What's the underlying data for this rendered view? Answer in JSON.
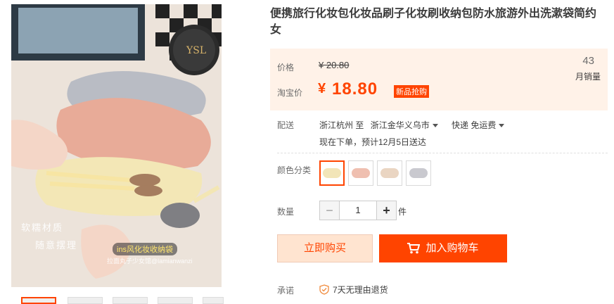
{
  "product": {
    "title": "便携旅行化妆包化妆品刷子化妆刷收纳包防水旅游外出洗漱袋简约女"
  },
  "photo": {
    "overlay_line1": "软糯材质",
    "overlay_line2": "随意摆理",
    "banner": "ins风化妆收纳袋",
    "handle": "拉面丸子少女馆@lamianwanzi"
  },
  "price": {
    "label": "价格",
    "original": "¥ 20.80",
    "tb_label": "淘宝价",
    "currency": "¥",
    "current": "18.80",
    "badge": "新品抢购",
    "sales_count": "43",
    "sales_label": "月销量"
  },
  "delivery": {
    "label": "配送",
    "from": "浙江杭州 至",
    "to": "浙江金华义乌市",
    "shipping": "快递 免运费",
    "note": "现在下单，预计12月5日送达"
  },
  "color": {
    "label": "颜色分类",
    "options": [
      "#f2e5b8",
      "#efbfb0",
      "#ead5c2",
      "#c9c9cf"
    ]
  },
  "quantity": {
    "label": "数量",
    "minus": "−",
    "value": "1",
    "plus": "+",
    "unit": "件"
  },
  "actions": {
    "buy_now": "立即购买",
    "add_cart": "加入购物车"
  },
  "promise": {
    "label": "承诺",
    "text": "7天无理由退货"
  },
  "colors": {
    "accent": "#ff4400",
    "price_bg": "#fff2e8"
  }
}
